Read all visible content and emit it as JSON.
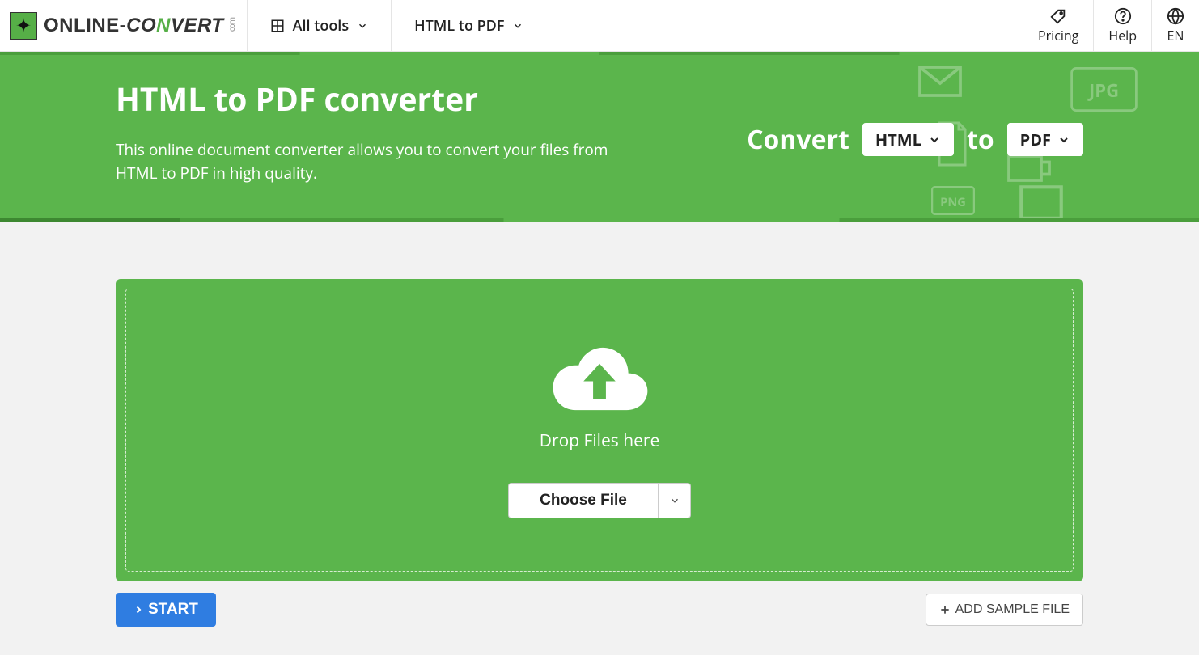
{
  "header": {
    "logo_text1": "ONLINE-",
    "logo_text2_pre": "CO",
    "logo_text2_n": "N",
    "logo_text2_post": "VERT",
    "logo_com": ".com",
    "nav_all_tools": "All tools",
    "nav_html_to_pdf": "HTML to PDF",
    "pricing": "Pricing",
    "help": "Help",
    "lang": "EN"
  },
  "hero": {
    "title": "HTML to PDF converter",
    "desc": "This online document converter allows you to convert your files from HTML to PDF in high quality.",
    "convert_label": "Convert",
    "from_value": "HTML",
    "to_label": "to",
    "to_value": "PDF"
  },
  "drop": {
    "text": "Drop Files here",
    "choose": "Choose File"
  },
  "actions": {
    "start": "START",
    "sample": "ADD SAMPLE FILE"
  }
}
